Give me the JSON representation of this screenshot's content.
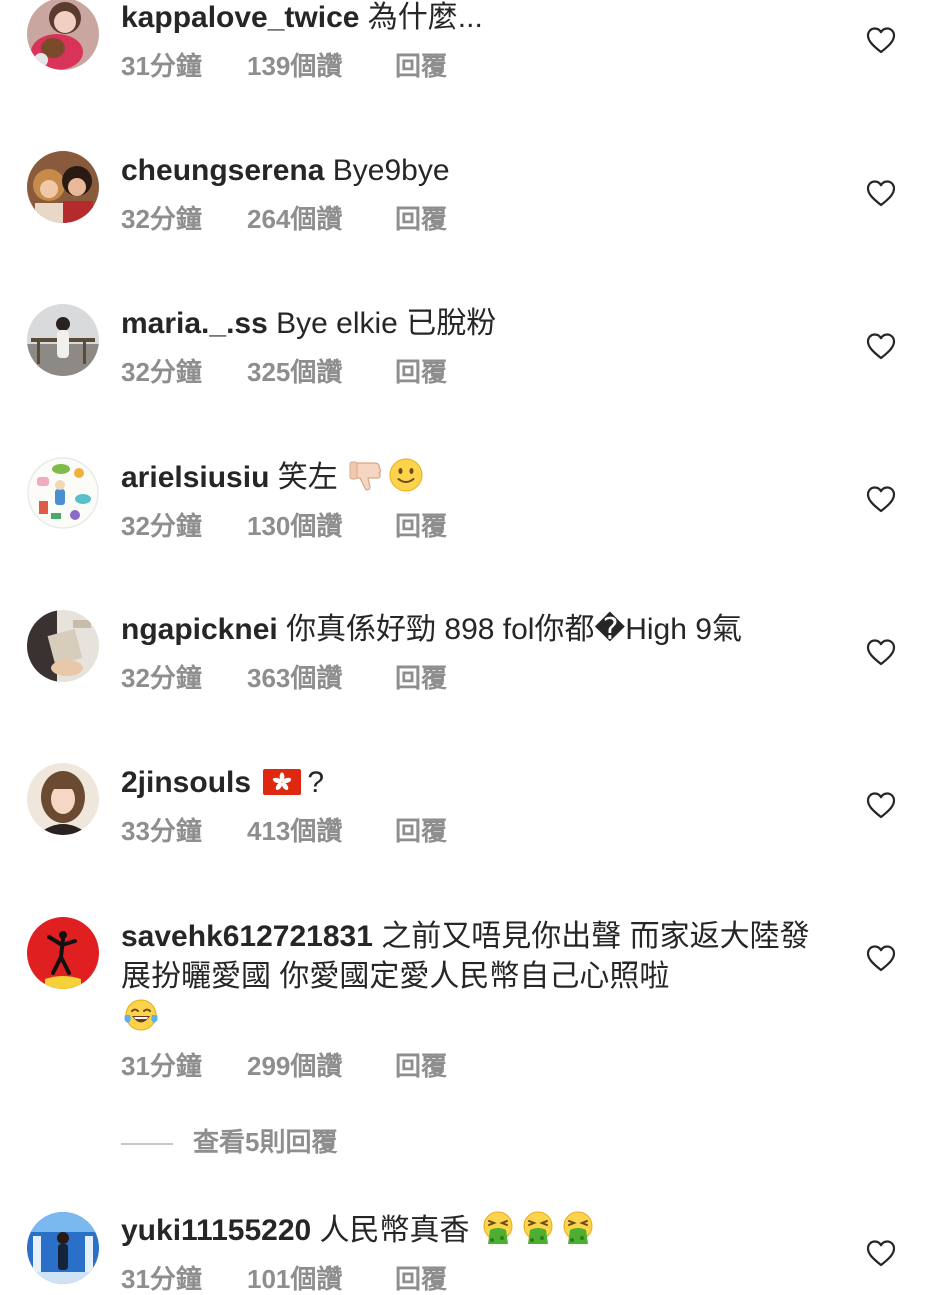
{
  "comments": [
    {
      "username": "kappalove_twice",
      "text": "為什麼...",
      "time": "31分鐘",
      "likes": "139個讚",
      "reply": "回覆"
    },
    {
      "username": "cheungserena",
      "text": "Bye9bye",
      "time": "32分鐘",
      "likes": "264個讚",
      "reply": "回覆"
    },
    {
      "username": "maria._.ss",
      "text": "Bye elkie 已脫粉",
      "time": "32分鐘",
      "likes": "325個讚",
      "reply": "回覆"
    },
    {
      "username": "arielsiusiu",
      "text": "笑左",
      "emojis": [
        "thumbs-down",
        "slightly-smiling-face"
      ],
      "time": "32分鐘",
      "likes": "130個讚",
      "reply": "回覆"
    },
    {
      "username": "ngapicknei",
      "text": "你真係好勁 898 fol你都�High 9氣",
      "time": "32分鐘",
      "likes": "363個讚",
      "reply": "回覆"
    },
    {
      "username": "2jinsouls",
      "text": "?",
      "emojis": [
        "hong-kong-flag"
      ],
      "time": "33分鐘",
      "likes": "413個讚",
      "reply": "回覆"
    },
    {
      "username": "savehk612721831",
      "text": "之前又唔見你出聲 而家返大陸發展扮曬愛國 你愛國定愛人民幣自己心照啦",
      "emojis": [
        "tears-of-joy"
      ],
      "time": "31分鐘",
      "likes": "299個讚",
      "reply": "回覆"
    },
    {
      "username": "yuki11155220",
      "text": "人民幣真香",
      "emojis": [
        "vomiting-face",
        "vomiting-face",
        "vomiting-face"
      ],
      "time": "31分鐘",
      "likes": "101個讚",
      "reply": "回覆"
    }
  ],
  "view_replies": "查看5則回覆",
  "colors": {
    "text": "#262626",
    "meta": "#8e8e8e",
    "background": "#ffffff"
  },
  "icons": {
    "like": "heart-outline-icon"
  }
}
